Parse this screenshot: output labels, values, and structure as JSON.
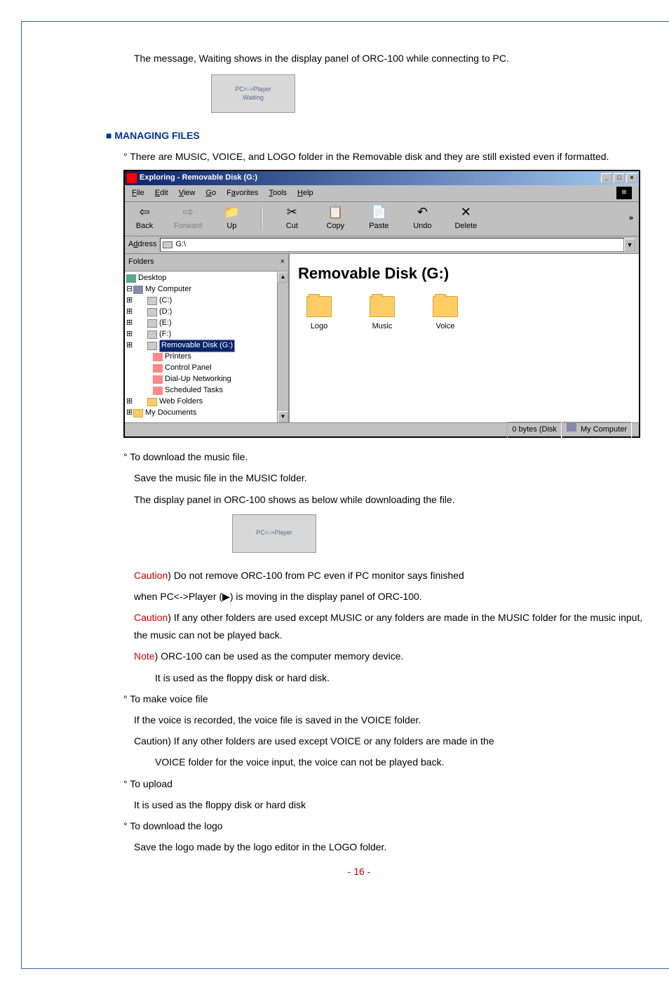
{
  "intro": "The message, Waiting shows in the display panel of ORC-100 while connecting to PC.",
  "panel1_line1": "PC<->Player",
  "panel1_line2": "Waiting",
  "section_heading": "■ MANAGING FILES",
  "bullet1": "° There are MUSIC, VOICE, and LOGO folder in the Removable disk and they are still existed even if formatted.",
  "explorer": {
    "title": "Exploring - Removable Disk (G:)",
    "menu": {
      "file": "File",
      "edit": "Edit",
      "view": "View",
      "go": "Go",
      "favorites": "Favorites",
      "tools": "Tools",
      "help": "Help"
    },
    "toolbar": {
      "back": "Back",
      "forward": "Forward",
      "up": "Up",
      "cut": "Cut",
      "copy": "Copy",
      "paste": "Paste",
      "undo": "Undo",
      "delete": "Delete"
    },
    "address_label": "Address",
    "address_value": "G:\\",
    "folders_label": "Folders",
    "tree": {
      "desktop": "Desktop",
      "my_computer": "My Computer",
      "c": "(C:)",
      "d": "(D:)",
      "e": "(E:)",
      "f": "(F:)",
      "g": "Removable Disk (G:)",
      "printers": "Printers",
      "control_panel": "Control Panel",
      "dialup": "Dial-Up Networking",
      "scheduled": "Scheduled Tasks",
      "web_folders": "Web Folders",
      "my_documents": "My Documents"
    },
    "content_title": "Removable Disk (G:)",
    "folders": {
      "logo": "Logo",
      "music": "Music",
      "voice": "Voice"
    },
    "status_bytes": "0 bytes (Disk",
    "status_location": "My Computer"
  },
  "bullet2": "° To download the music file.",
  "sub2a": "Save the music file in the MUSIC folder.",
  "sub2b": "The display panel in ORC-100 shows as below while downloading the file.",
  "panel2": "PC<->Player",
  "caution1_label": "Caution",
  "caution1_text": ") Do not remove ORC-100 from PC even if PC monitor says finished",
  "caution1_line2": "when PC<->Player (▶) is moving in the display panel of ORC-100.",
  "caution2_label": "Caution",
  "caution2_text": ") If any other folders are used except MUSIC or any folders are made in the MUSIC folder for the music input, the music can not be played back.",
  "note_label": "Note",
  "note_text": ") ORC-100 can be used as the computer memory device.",
  "note_sub": "It is used as the floppy disk or hard disk.",
  "bullet3": "° To make voice file",
  "sub3a": "If the voice is recorded, the voice file is saved in the VOICE folder.",
  "sub3b": "Caution) If any other folders are used except VOICE or any folders are made in the",
  "sub3c": "VOICE folder for the voice input, the voice can not be played back.",
  "bullet4": "° To upload",
  "sub4a": "It is used as the floppy disk or hard disk",
  "bullet5": "° To download the logo",
  "sub5a": "Save the logo made by the logo editor in the LOGO folder.",
  "page_number": "- 16 -"
}
